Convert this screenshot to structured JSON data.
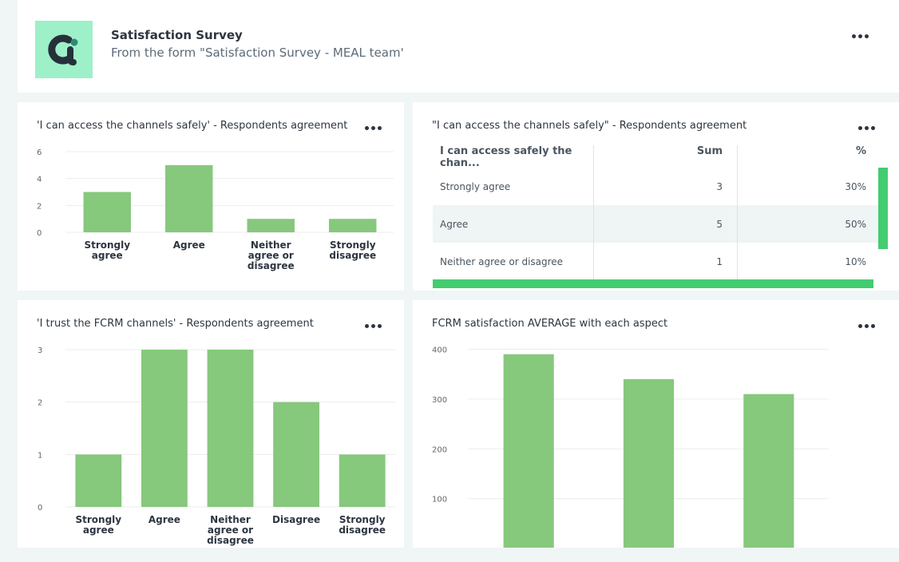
{
  "header": {
    "title": "Satisfaction Survey",
    "subtitle": "From the form \"Satisfaction Survey - MEAL team'",
    "logo_icon": "ci-logo-icon",
    "menu_icon": "more-horizontal-icon"
  },
  "colors": {
    "bar": "#86c87c",
    "accent": "#44cc70",
    "logo_bg": "#9ef0c8",
    "page_bg": "#f0f6f5"
  },
  "cards": {
    "access_chart": {
      "title": "'I can access the channels safely' - Respondents agreement"
    },
    "access_table": {
      "title": "\"I can access the channels safely\" - Respondents agreement",
      "columns": [
        "I can access safely the chan...",
        "Sum",
        "%"
      ],
      "rows": [
        [
          "Strongly agree",
          "3",
          "30%"
        ],
        [
          "Agree",
          "5",
          "50%"
        ],
        [
          "Neither agree or disagree",
          "1",
          "10%"
        ]
      ]
    },
    "trust_chart": {
      "title": "'I trust the FCRM channels' - Respondents agreement"
    },
    "average_chart": {
      "title": "FCRM satisfaction AVERAGE with each aspect"
    }
  },
  "chart_data": [
    {
      "type": "bar",
      "title": "'I can access the channels safely' - Respondents agreement",
      "categories": [
        [
          "Strongly",
          "agree"
        ],
        [
          "Agree"
        ],
        [
          "Neither",
          "agree or",
          "disagree"
        ],
        [
          "Strongly",
          "disagree"
        ]
      ],
      "values": [
        3,
        5,
        1,
        1
      ],
      "yticks": [
        0,
        2,
        4,
        6
      ],
      "ylim": [
        0,
        6
      ],
      "xlabel": "",
      "ylabel": "",
      "grid": true
    },
    {
      "type": "bar",
      "title": "'I trust the FCRM channels' - Respondents agreement",
      "categories": [
        [
          "Strongly",
          "agree"
        ],
        [
          "Agree"
        ],
        [
          "Neither",
          "agree or",
          "disagree"
        ],
        [
          "Disagree"
        ],
        [
          "Strongly",
          "disagree"
        ]
      ],
      "values": [
        1,
        3,
        3,
        2,
        1
      ],
      "yticks": [
        0,
        1,
        2,
        3
      ],
      "ylim": [
        0,
        3
      ],
      "xlabel": "",
      "ylabel": "",
      "grid": true
    },
    {
      "type": "bar",
      "title": "FCRM satisfaction AVERAGE with each aspect",
      "categories": [
        "",
        "",
        ""
      ],
      "values": [
        390,
        340,
        310
      ],
      "yticks": [
        100,
        200,
        300,
        400
      ],
      "ylim": [
        0,
        400
      ],
      "xlabel": "",
      "ylabel": "",
      "grid": true
    }
  ]
}
